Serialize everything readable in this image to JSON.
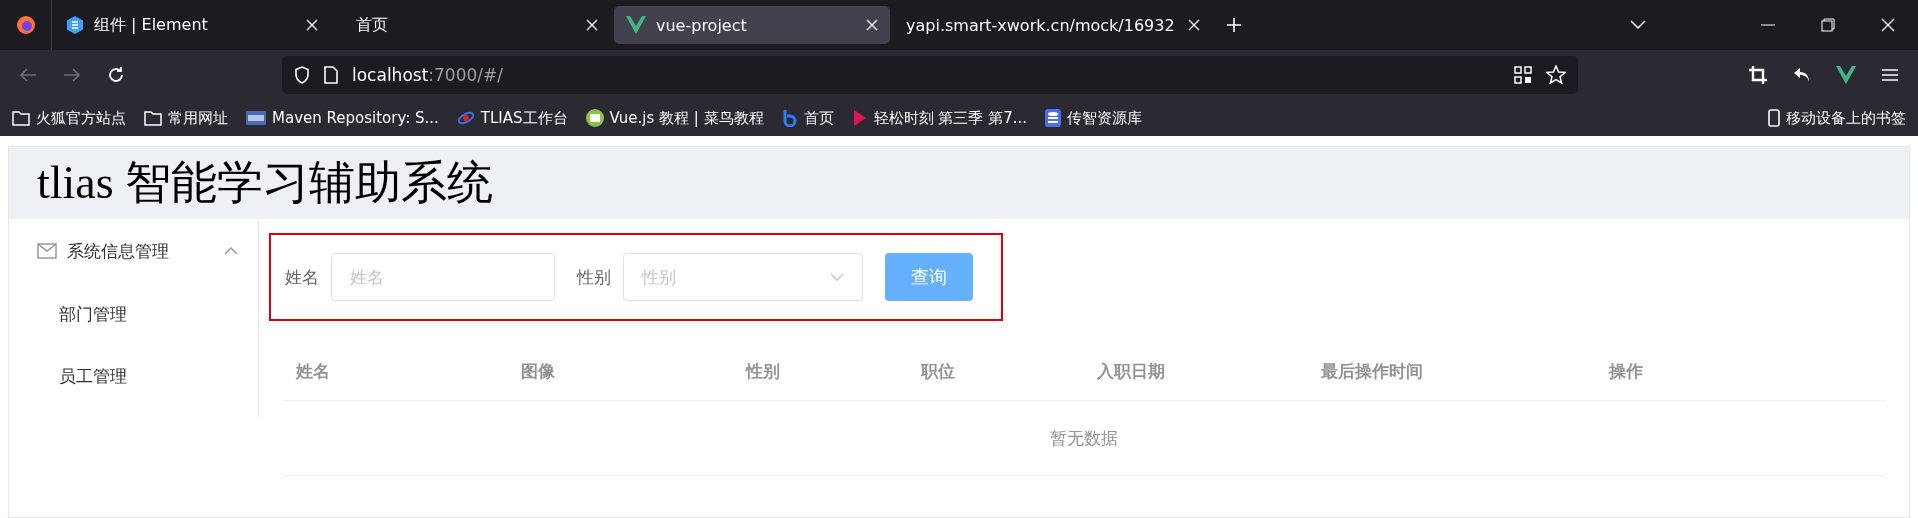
{
  "browser": {
    "tabs": [
      {
        "title": "组件 | Element",
        "kind": "element",
        "selected": false
      },
      {
        "title": "首页",
        "kind": "blank",
        "selected": false
      },
      {
        "title": "vue-project",
        "kind": "vue",
        "selected": true
      },
      {
        "title": "yapi.smart-xwork.cn/mock/16932",
        "kind": "blank",
        "selected": false
      }
    ],
    "url": {
      "host": "localhost",
      "rest": ":7000/#/"
    },
    "bookmarks": [
      {
        "label": "火狐官方站点",
        "kind": "folder"
      },
      {
        "label": "常用网址",
        "kind": "folder"
      },
      {
        "label": "Maven Repository: S...",
        "kind": "maven"
      },
      {
        "label": "TLIAS工作台",
        "kind": "swirl"
      },
      {
        "label": "Vue.js 教程 | 菜鸟教程",
        "kind": "code"
      },
      {
        "label": "首页",
        "kind": "b"
      },
      {
        "label": "轻松时刻 第三季 第7...",
        "kind": "play"
      },
      {
        "label": "传智资源库",
        "kind": "db"
      }
    ],
    "mobile_bookmarks": "移动设备上的书签"
  },
  "app": {
    "title": "tlias 智能学习辅助系统",
    "menu": {
      "label": "系统信息管理",
      "expanded": true,
      "children": [
        {
          "label": "部门管理"
        },
        {
          "label": "员工管理"
        }
      ]
    },
    "search": {
      "fields": [
        {
          "label": "姓名",
          "placeholder": "姓名",
          "kind": "input"
        },
        {
          "label": "性别",
          "placeholder": "性别",
          "kind": "select"
        }
      ],
      "button": "查询"
    },
    "table": {
      "columns": [
        "姓名",
        "图像",
        "性别",
        "职位",
        "入职日期",
        "最后操作时间",
        "操作"
      ],
      "empty_text": "暂无数据"
    }
  }
}
